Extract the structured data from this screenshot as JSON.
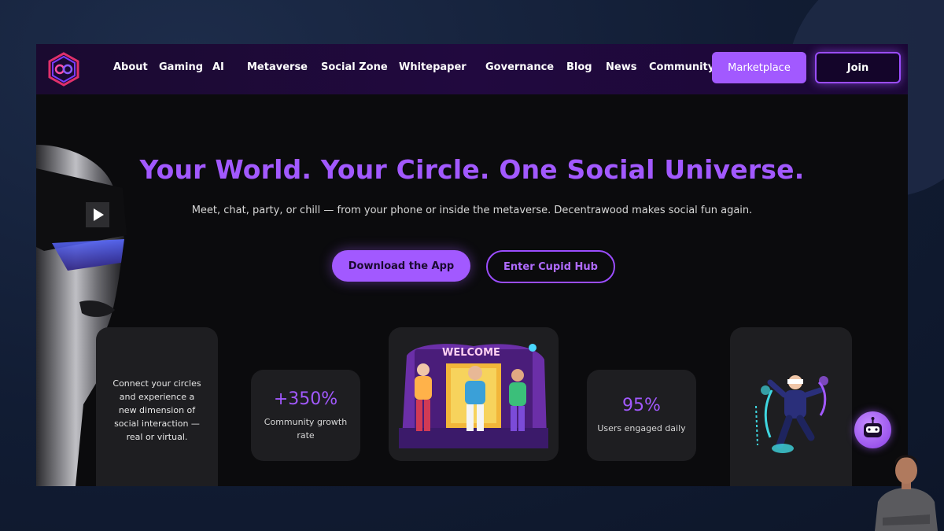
{
  "nav": {
    "links": [
      "About",
      "Gaming",
      "AI",
      "Metaverse",
      "Social Zone",
      "Whitepaper",
      "Governance",
      "Blog",
      "News",
      "Community"
    ],
    "marketplace_label": "Marketplace",
    "join_label": "Join"
  },
  "hero": {
    "headline": "Your World. Your Circle. One Social Universe.",
    "subline": "Meet, chat, party, or chill — from your phone or inside the metaverse. Decentrawood makes social fun again.",
    "download_label": "Download the App",
    "cupid_label": "Enter Cupid Hub"
  },
  "cards": {
    "intro_text": "Connect your circles and experience a new dimension of social interaction — real or virtual.",
    "stat1": {
      "value": "+350%",
      "label": "Community growth rate"
    },
    "stat2": {
      "value": "95%",
      "label": "Users engaged daily"
    },
    "welcome_sign": "WELCOME"
  },
  "colors": {
    "accent": "#a259ff",
    "nav_bg": "#21093f",
    "card_bg": "#1e1e21",
    "page_bg": "#0b0b0d"
  },
  "icons": {
    "logo": "infinity-hexagon-logo",
    "bot": "robot-icon",
    "play": "play-icon"
  }
}
